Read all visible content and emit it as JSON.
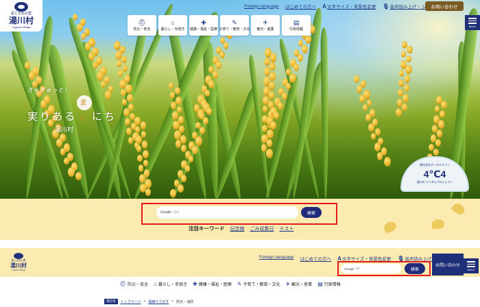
{
  "logo": {
    "sub": "星と文化の里",
    "name": "湯川村",
    "en": "Yugawa Village"
  },
  "utility_links": [
    {
      "icon": "",
      "label": "Foreign language"
    },
    {
      "icon": "",
      "label": "はじめての方へ"
    },
    {
      "icon": "A",
      "label": "文字サイズ・背景色変更"
    },
    {
      "icon": "🎙",
      "label": "音声読み上げ・ふりがな"
    }
  ],
  "contact_label": "お問い合わせ",
  "menu_label": "Menu",
  "global_nav": [
    {
      "icon": "⛑",
      "label": "防災・安全"
    },
    {
      "icon": "⌂",
      "label": "暮らし・手続き"
    },
    {
      "icon": "✚",
      "label": "健康・福祉・医療"
    },
    {
      "icon": "✎",
      "label": "子育て・教育・文化"
    },
    {
      "icon": "✈",
      "label": "観光・産業"
    },
    {
      "icon": "▤",
      "label": "行政情報"
    }
  ],
  "catch": {
    "line1": "ぎゅぎゅっと！",
    "line2a": "実りある",
    "mai": "まい",
    "line2b": "にち",
    "line3": "湯川村"
  },
  "badge": {
    "top": "移住定住ポータルサイト",
    "main": "4℃4",
    "sub": "湯川村 ランダムプロジェクト"
  },
  "search": {
    "google": "Google",
    "placeholder": "提供",
    "button": "検索"
  },
  "keywords": {
    "title": "注目キーワード",
    "items": [
      "記念館",
      "ごみ収集日",
      "テスト"
    ]
  },
  "header2": {
    "logo": {
      "sub": "星と文化の里",
      "name": "湯川村",
      "en": "Yugawa Village"
    },
    "search": {
      "google": "Google",
      "placeholder": "提供",
      "button": "検索"
    }
  },
  "breadcrumb": {
    "now_label": "現在地",
    "items": [
      "トップページ",
      "組織でさがす"
    ],
    "current": "防災・消防"
  }
}
